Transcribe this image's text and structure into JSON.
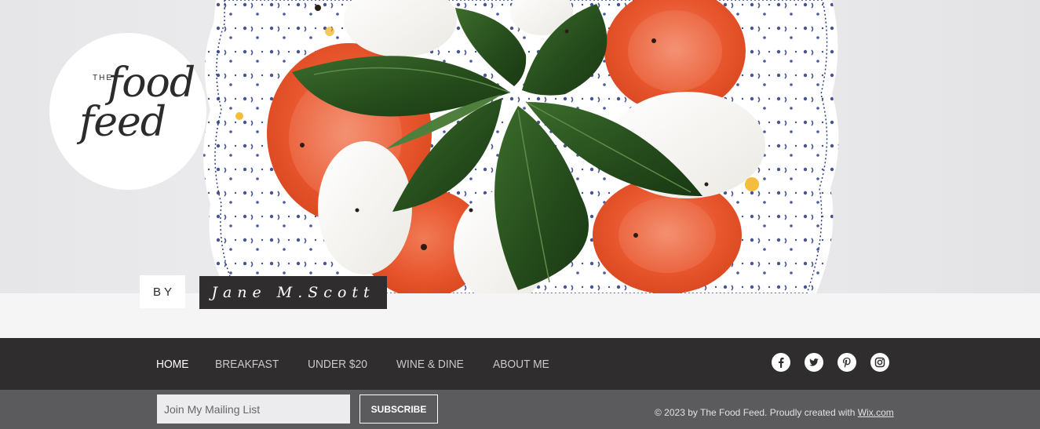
{
  "brand": {
    "logo_the": "THE",
    "logo_food": "food",
    "logo_feed": "feed"
  },
  "hero": {
    "by_label": "BY",
    "author": "Jane M.Scott"
  },
  "nav": {
    "items": [
      {
        "label": "HOME",
        "active": true
      },
      {
        "label": "BREAKFAST",
        "active": false
      },
      {
        "label": "UNDER $20",
        "active": false
      },
      {
        "label": "WINE & DINE",
        "active": false
      },
      {
        "label": "ABOUT ME",
        "active": false
      }
    ]
  },
  "social": {
    "icons": [
      "facebook-icon",
      "twitter-icon",
      "pinterest-icon",
      "instagram-icon"
    ]
  },
  "footer": {
    "mailing_placeholder": "Join My Mailing List",
    "subscribe_label": "SUBSCRIBE",
    "copyright_text": "© 2023 by The Food Feed. Proudly created with ",
    "copyright_link": "Wix.com"
  },
  "colors": {
    "nav_bg": "#2f2d2e",
    "footer_bg": "#5b5b5d",
    "tomato": "#e8613a",
    "basil": "#2f5a23"
  }
}
